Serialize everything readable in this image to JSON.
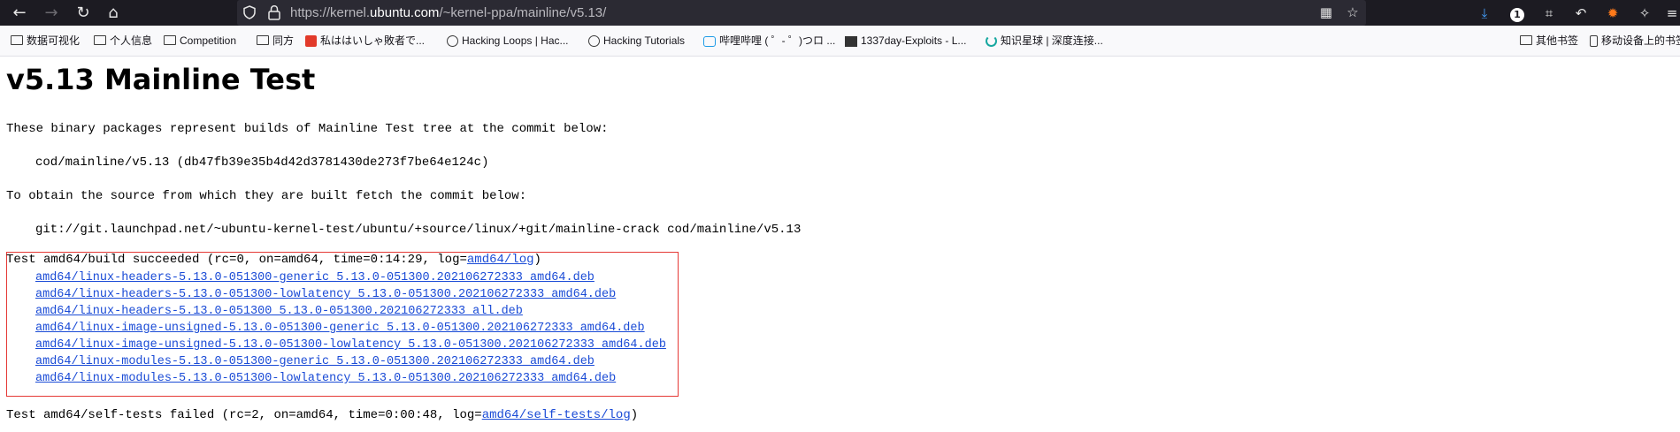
{
  "browser": {
    "url_prefix": "https://kernel.",
    "url_host": "ubuntu.com",
    "url_path": "/~kernel-ppa/mainline/v5.13/",
    "notification_count": "1"
  },
  "bookmarks": [
    {
      "label": "数据可视化",
      "icon": "folder"
    },
    {
      "label": "个人信息",
      "icon": "folder"
    },
    {
      "label": "Competition",
      "icon": "folder"
    },
    {
      "label": "同方",
      "icon": "folder"
    },
    {
      "label": "私ははいしゃ敗者で...",
      "icon": "red-square"
    },
    {
      "label": "Hacking Loops | Hac...",
      "icon": "globe"
    },
    {
      "label": "Hacking Tutorials",
      "icon": "globe"
    },
    {
      "label": "哔哩哔哩 ( ゜- ゜)つロ ...",
      "icon": "tv"
    },
    {
      "label": "1337day-Exploits - L...",
      "icon": "dark-square"
    },
    {
      "label": "知识星球 | 深度连接...",
      "icon": "ring"
    }
  ],
  "bookmarks_right": [
    {
      "label": "其他书签",
      "icon": "folder"
    },
    {
      "label": "移动设备上的书签",
      "icon": "phone"
    }
  ],
  "content": {
    "title": "v5.13 Mainline Test",
    "intro": "These binary packages represent builds of Mainline Test tree at the commit below:",
    "commit_line": "cod/mainline/v5.13 (db47fb39e35b4d42d3781430de273f7be64e124c)",
    "fetch_intro": "To obtain the source from which they are built fetch the commit below:",
    "fetch_line": "git://git.launchpad.net/~ubuntu-kernel-test/ubuntu/+source/linux/+git/mainline-crack cod/mainline/v5.13",
    "build_status": "Test amd64/build succeeded (rc=0, on=amd64, time=0:14:29, log=",
    "build_log_link": "amd64/log",
    "build_close": ")",
    "files": [
      "amd64/linux-headers-5.13.0-051300-generic_5.13.0-051300.202106272333_amd64.deb",
      "amd64/linux-headers-5.13.0-051300-lowlatency_5.13.0-051300.202106272333_amd64.deb",
      "amd64/linux-headers-5.13.0-051300_5.13.0-051300.202106272333_all.deb",
      "amd64/linux-image-unsigned-5.13.0-051300-generic_5.13.0-051300.202106272333_amd64.deb",
      "amd64/linux-image-unsigned-5.13.0-051300-lowlatency_5.13.0-051300.202106272333_amd64.deb",
      "amd64/linux-modules-5.13.0-051300-generic_5.13.0-051300.202106272333_amd64.deb",
      "amd64/linux-modules-5.13.0-051300-lowlatency_5.13.0-051300.202106272333_amd64.deb"
    ],
    "selftest_status": "Test amd64/self-tests failed (rc=2, on=amd64, time=0:00:48, log=",
    "selftest_log_link": "amd64/self-tests/log",
    "selftest_close": ")"
  },
  "colors": {
    "link": "#1a4bd6",
    "highlight_box": "#e53935",
    "toolbar_bg": "#1c1b22"
  }
}
